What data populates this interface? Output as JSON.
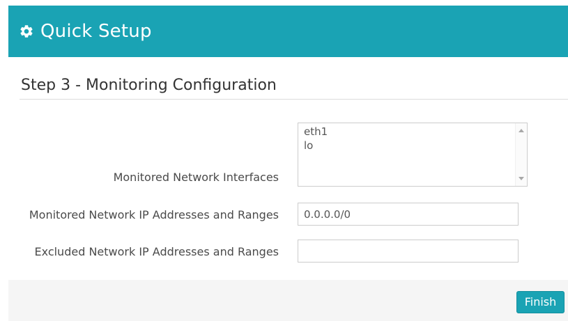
{
  "header": {
    "title": "Quick Setup",
    "icon": "gear-icon",
    "background_color": "#1aa3b4"
  },
  "step": {
    "title": "Step 3 - Monitoring Configuration"
  },
  "form": {
    "interfaces": {
      "label": "Monitored Network Interfaces",
      "options": [
        "eth1",
        "lo"
      ]
    },
    "monitored_ranges": {
      "label": "Monitored Network IP Addresses and Ranges",
      "value": "0.0.0.0/0",
      "placeholder": ""
    },
    "excluded_ranges": {
      "label": "Excluded Network IP Addresses and Ranges",
      "value": "",
      "placeholder": ""
    }
  },
  "footer": {
    "finish_label": "Finish",
    "accent_color": "#1aa3b4"
  }
}
